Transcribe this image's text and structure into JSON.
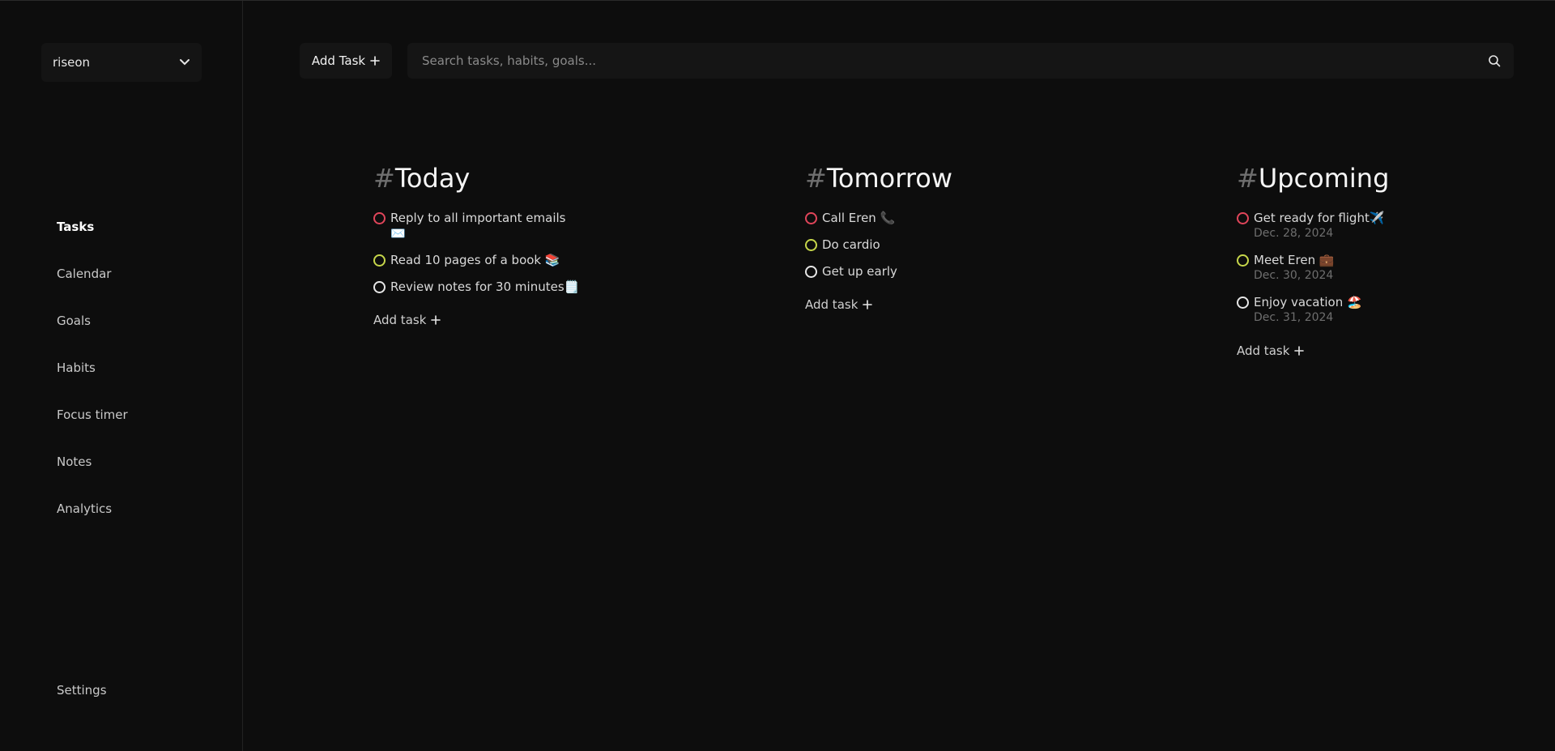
{
  "workspace": {
    "name": "riseon"
  },
  "nav": {
    "items": [
      {
        "label": "Tasks",
        "active": true
      },
      {
        "label": "Calendar"
      },
      {
        "label": "Goals"
      },
      {
        "label": "Habits"
      },
      {
        "label": "Focus timer"
      },
      {
        "label": "Notes"
      },
      {
        "label": "Analytics"
      }
    ],
    "settings_label": "Settings"
  },
  "toolbar": {
    "add_task_label": "Add Task",
    "search_placeholder": "Search tasks, habits, goals..."
  },
  "columns": {
    "today": {
      "hash": "#",
      "title": "Today",
      "tasks": [
        {
          "line1": "Reply to all important emails",
          "line2": "✉️",
          "priority_color": "#e0455a"
        },
        {
          "line1": "Read 10 pages of a book 📚",
          "priority_color": "#c6d64a"
        },
        {
          "line1": "Review notes for 30 minutes🗒️",
          "priority_color": "#e6e6e6"
        }
      ],
      "add_label": "Add task"
    },
    "tomorrow": {
      "hash": "#",
      "title": "Tomorrow",
      "tasks": [
        {
          "line1": "Call Eren 📞",
          "priority_color": "#e0455a"
        },
        {
          "line1": "Do cardio",
          "priority_color": "#c6d64a"
        },
        {
          "line1": "Get up early",
          "priority_color": "#e6e6e6"
        }
      ],
      "add_label": "Add task"
    },
    "upcoming": {
      "hash": "#",
      "title": "Upcoming",
      "tasks": [
        {
          "line1": "Get ready for flight✈️",
          "date": "Dec. 28, 2024",
          "priority_color": "#e0455a"
        },
        {
          "line1": "Meet Eren 💼",
          "date": "Dec. 30, 2024",
          "priority_color": "#c6d64a"
        },
        {
          "line1": "Enjoy vacation 🏖️",
          "date": "Dec. 31, 2024",
          "priority_color": "#e6e6e6"
        }
      ],
      "add_label": "Add task"
    }
  },
  "icons": {
    "workspace_dropdown": "chevron-down-icon",
    "add_task": "plus-icon",
    "search": "search-icon",
    "task_status": "circle-icon"
  }
}
